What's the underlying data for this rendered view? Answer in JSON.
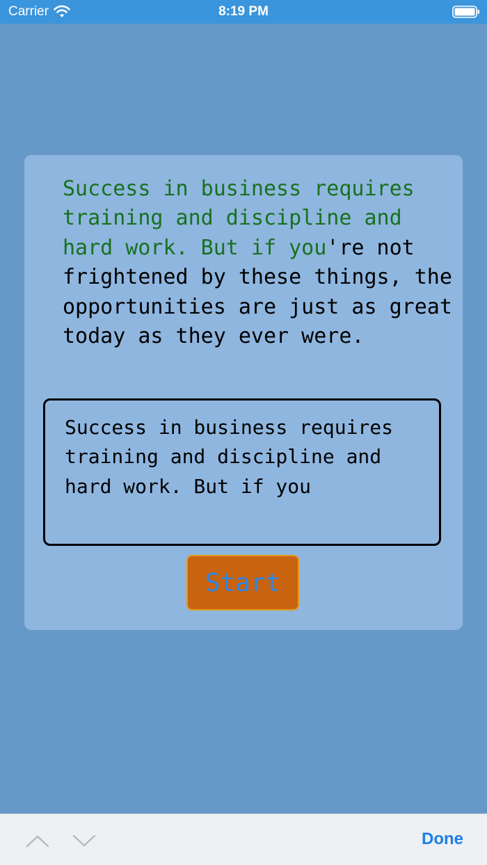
{
  "status_bar": {
    "carrier": "Carrier",
    "time": "8:19 PM",
    "wifi_icon": "wifi-icon",
    "battery_icon": "battery-icon",
    "background": "#3b95dc"
  },
  "quote": {
    "typed_part": "Success in business requires training and discipline and hard work. But if you",
    "remaining_part": "'re not frightened by these things, the opportunities are just as great today as they ever were.",
    "typed_color": "#17711f",
    "remaining_color": "#000000"
  },
  "input": {
    "value": "Success in business requires training and discipline and hard work. But if you"
  },
  "start_button": {
    "label": "Start",
    "background": "#c8640f",
    "text_color": "#2d84e6"
  },
  "accessory_bar": {
    "up_icon": "chevron-up-icon",
    "down_icon": "chevron-down-icon",
    "done_label": "Done",
    "done_color": "#1f7fe6"
  },
  "colors": {
    "page_background": "#6699c8",
    "card_background": "#8fb6df"
  }
}
